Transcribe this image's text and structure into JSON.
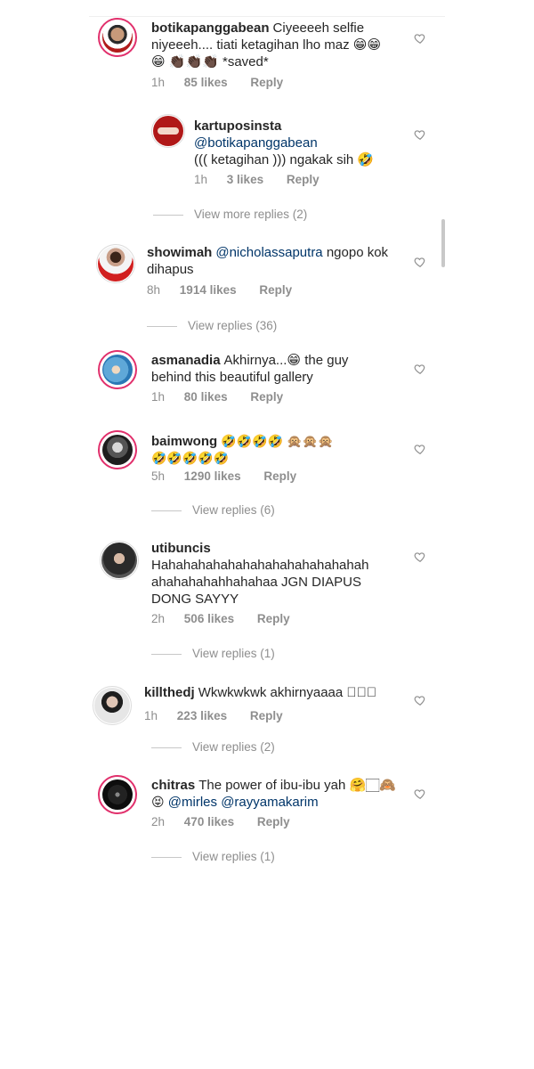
{
  "comments": [
    {
      "username": "botikapanggabean",
      "text": "Ciyeeeeh selfie niyeeeh.... tiati ketagihan lho maz 😁😁😁 👏🏿👏🏿👏🏿 *saved*",
      "line1": "Ciyeeeeh selfie",
      "line2": "niyeeeh.... tiati ketagihan lho maz 😁😁",
      "line3": "😁 👏🏿👏🏿👏🏿 *saved*",
      "time": "1h",
      "likes": "85 likes",
      "reply": "Reply"
    },
    {
      "username": "kartuposinsta",
      "mention": "@botikapanggabean",
      "text": "((( ketagihan ))) ngakak sih 🤣",
      "time": "1h",
      "likes": "3 likes",
      "reply": "Reply",
      "view_replies": "View more replies (2)"
    },
    {
      "username": "showimah",
      "mention": "@nicholassaputra",
      "text_a": "ngopo kok",
      "text_b": "dihapus",
      "time": "8h",
      "likes": "1914 likes",
      "reply": "Reply",
      "view_replies": "View replies (36)"
    },
    {
      "username": "asmanadia",
      "text_a": "Akhirnya...😁 the guy",
      "text_b": "behind this  beautiful gallery",
      "time": "1h",
      "likes": "80 likes",
      "reply": "Reply"
    },
    {
      "username": "baimwong",
      "text_a": "🤣🤣🤣🤣 🙊🙊🙊",
      "text_b": "🤣🤣🤣🤣🤣",
      "time": "5h",
      "likes": "1290 likes",
      "reply": "Reply",
      "view_replies": "View replies (6)"
    },
    {
      "username": "utibuncis",
      "text_a": "Hahahahahahahahahahahahahahah",
      "text_b": "ahahahahahhahahaa JGN DIAPUS",
      "text_c": "DONG SAYYY",
      "time": "2h",
      "likes": "506 likes",
      "reply": "Reply",
      "view_replies": "View replies (1)"
    },
    {
      "username": "killthedj",
      "text": "Wkwkwkwk akhirnyaaaa 🏻🏻🏻",
      "time": "1h",
      "likes": "223 likes",
      "reply": "Reply",
      "view_replies": "View replies (2)"
    },
    {
      "username": "chitras",
      "text_a": "The power of ibu-ibu yah 🤗🏻🙈",
      "text_b_emoji": "😝",
      "mention_1": "@mirles",
      "mention_2": "@rayyamakarim",
      "time": "2h",
      "likes": "470 likes",
      "reply": "Reply",
      "view_replies": "View replies (1)"
    }
  ],
  "colors": {
    "story_ring": "#e1306c",
    "mention": "#003569",
    "meta": "#8e8e8e"
  },
  "icons": {
    "like": "heart-outline-icon"
  }
}
